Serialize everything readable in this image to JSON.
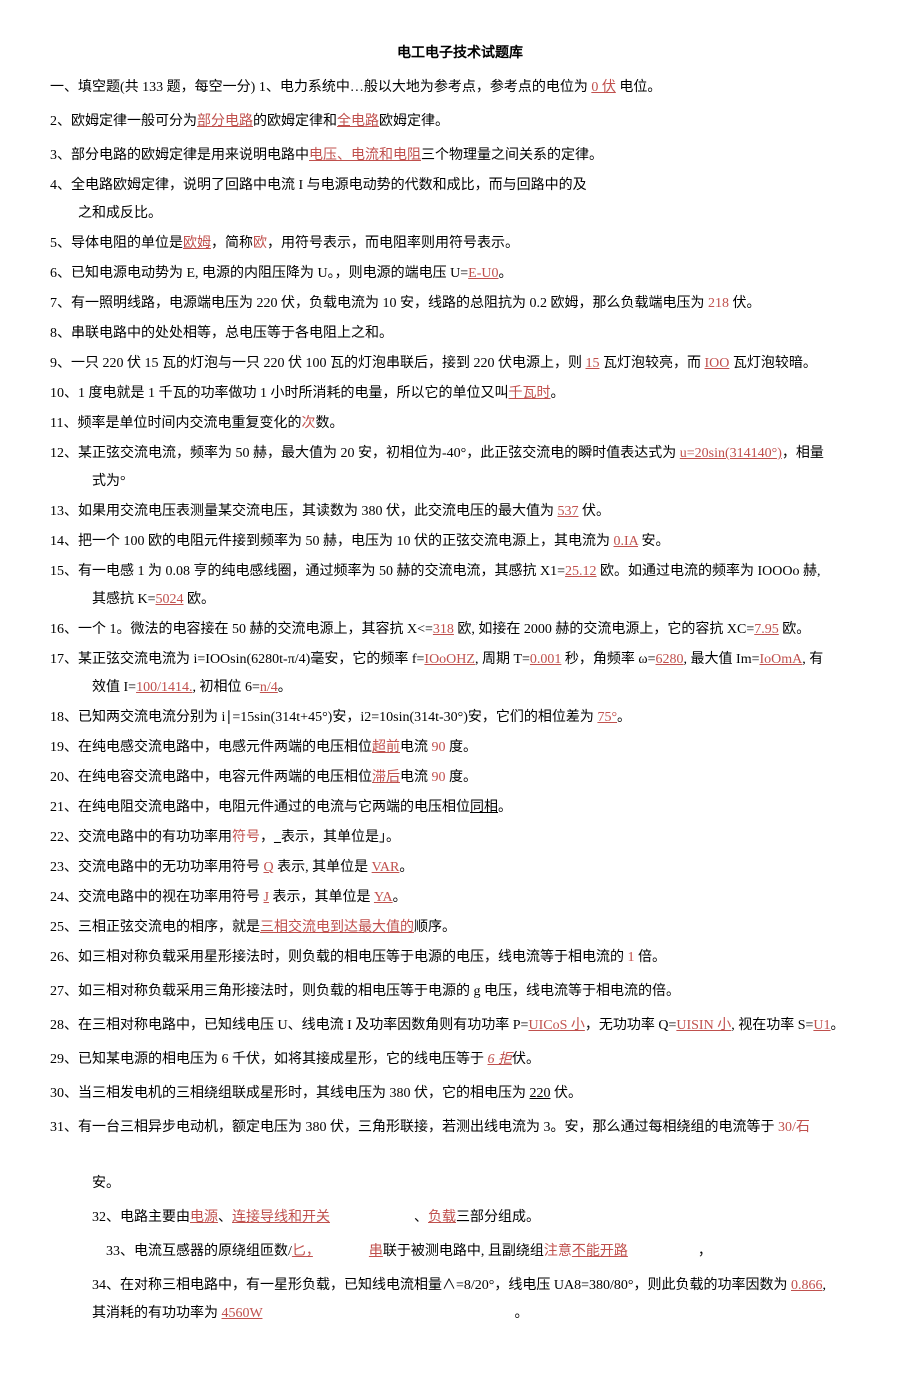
{
  "title": "电工电子技术试题库",
  "header_line_prefix": "一、填空题(共 133 题，每空一分) 1、电力系统中…般以大地为参考点，参考点的电位为 ",
  "header_line_ans": "0 伏",
  "header_line_suffix": " 电位。",
  "rows": {
    "r2": {
      "pre": "2、欧姆定律一般可分为",
      "a1": "部分电路",
      "mid": "的欧姆定律和",
      "a2": "全电路",
      "suf": "欧姆定律。"
    },
    "r3": {
      "pre": "3、部分电路的欧姆定律是用来说明电路中",
      "a1": "电压、电流和电阻",
      "suf": "三个物理量之间关系的定律。"
    },
    "r4": {
      "l1": "4、全电路欧姆定律，说明了回路中电流 I 与电源电动势的代数和成比，而与回路中的及",
      "l2": "之和成反比。"
    },
    "r5": {
      "pre": "5、导体电阻的单位是",
      "a1": "欧姆",
      "mid": "，简称",
      "a2": "欧",
      "suf": "，用符号表示，而电阻率则用符号表示。"
    },
    "r6": {
      "pre": "6、已知电源电动势为 E, 电源的内阻压降为 U。，则电源的端电压 U=",
      "a1": "E-U0",
      "suf": "。"
    },
    "r7": {
      "pre": "7、有一照明线路，电源端电压为 220 伏，负载电流为 10 安，线路的总阻抗为 0.2 欧姆，那么负载端电压为 ",
      "a1": "218",
      "suf": " 伏。"
    },
    "r8": {
      "text": "8、串联电路中的处处相等，总电压等于各电阻上之和。"
    },
    "r9": {
      "pre": "9、一只 220 伏 15 瓦的灯泡与一只 220 伏 100 瓦的灯泡串联后，接到 220 伏电源上，则 ",
      "a1": "15",
      "mid": " 瓦灯泡较亮，而 ",
      "a2": "IOO",
      "suf": " 瓦灯泡较暗。"
    },
    "r10": {
      "pre": "10、1 度电就是 1 千瓦的功率做功 1 小时所消耗的电量，所以它的单位又叫",
      "a1": "千瓦时",
      "suf": "。"
    },
    "r11": {
      "pre": "11、频率是单位时间内交流电重复变化的",
      "a1": "次",
      "suf": "数。"
    },
    "r12": {
      "l1_pre": "12、某正弦交流电流，频率为 50 赫，最大值为 20 安，初相位为-40°，此正弦交流电的瞬时值表达式为 ",
      "l1_a": "u=20sin(314140°)",
      "l1_suf": "，相量",
      "l2": "式为°"
    },
    "r13": {
      "pre": "13、如果用交流电压表测量某交流电压，其读数为 380 伏，此交流电压的最大值为 ",
      "a1": "537",
      "suf": " 伏。"
    },
    "r14": {
      "pre": "14、把一个 100 欧的电阻元件接到频率为 50 赫，电压为 10 伏的正弦交流电源上，其电流为 ",
      "a1": "0.IA",
      "suf": " 安。"
    },
    "r15": {
      "l1_pre": "15、有一电感 1 为 0.08 亨的纯电感线圈，通过频率为 50 赫的交流电流，其感抗 X1=",
      "l1_a": "25.12",
      "l1_suf": " 欧。如通过电流的频率为 IOOOo 赫,",
      "l2_pre": "其感抗 K=",
      "l2_a": "5024",
      "l2_suf": " 欧。"
    },
    "r16": {
      "pre": "16、一个 1。微法的电容接在 50 赫的交流电源上，其容抗 X<=",
      "a1": "318",
      "mid": " 欧, 如接在 2000 赫的交流电源上，它的容抗 XC=",
      "a2": "7.95",
      "suf": " 欧。"
    },
    "r17": {
      "l1_pre": "17、某正弦交流电流为 i=IOOsin(6280t-π/4)毫安，它的频率 f=",
      "l1_a1": "IOoOHZ",
      "l1_m1": ", 周期 T=",
      "l1_a2": "0.001",
      "l1_m2": " 秒，角频率 ω=",
      "l1_a3": "6280",
      "l1_m3": ", 最大值 Im=",
      "l1_a4": "IoOmA",
      "l1_suf": ", 有",
      "l2_pre": "效值 I=",
      "l2_a1": "100/1414.",
      "l2_m": ", 初相位 6=",
      "l2_a2": "n/4",
      "l2_suf": "。"
    },
    "r18": {
      "pre": "18、已知两交流电流分别为 i∣=15sin(314t+45°)安，i2=10sin(314t-30°)安，它们的相位差为 ",
      "a1": "75°",
      "suf": "。"
    },
    "r19": {
      "pre": "19、在纯电感交流电路中，电感元件两端的电压相位",
      "a1": "超前",
      "mid": "电流 ",
      "a2": "90",
      "suf": " 度。"
    },
    "r20": {
      "pre": "20、在纯电容交流电路中，电容元件两端的电压相位",
      "a1": "滞后",
      "mid": "电流 ",
      "a2": "90",
      "suf": " 度。"
    },
    "r21": {
      "pre": "21、在纯电阻交流电路中，电阻元件通过的电流与它两端的电压相位",
      "u": "同相",
      "suf": "。"
    },
    "r22": {
      "pre": "22、交流电路中的有功功率用",
      "a1": "符号",
      "mid": "，",
      "u": "_",
      "suf": "表示，其单位是」。"
    },
    "r23": {
      "pre": "23、交流电路中的无功功率用符号 ",
      "a1": "Q",
      "mid": " 表示, 其单位是 ",
      "a2": "VAR",
      "suf": "。"
    },
    "r24": {
      "pre": "24、交流电路中的视在功率用符号 ",
      "a1": "J",
      "mid": " 表示，其单位是 ",
      "a2": "YA",
      "suf": "。"
    },
    "r25": {
      "pre": "25、三相正弦交流电的相序，就是",
      "a1": "三相交流电到达最大值的",
      "suf": "顺序。"
    },
    "r26": {
      "pre": "26、如三相对称负载采用星形接法时，则负载的相电压等于电源的电压，线电流等于相电流的 ",
      "a1": "1",
      "suf": " 倍。"
    },
    "r27": {
      "text": "27、如三相对称负载采用三角形接法时，则负载的相电压等于电源的 g 电压，线电流等于相电流的倍。"
    },
    "r28": {
      "pre": "28、在三相对称电路中，已知线电压 U、线电流 I 及功率因数角则有功功率 P=",
      "a1": "UICoS 小",
      "mid": "，无功功率 Q=",
      "a2": "UISIN 小",
      "mid2": ", 视在功率 S=",
      "a3": "U1",
      "suf": "。"
    },
    "r29": {
      "pre": "29、已知某电源的相电压为 6 千伏，如将其接成星形，它的线电压等于 ",
      "a1": "6 拒",
      "suf": "伏。"
    },
    "r30": {
      "pre": "30、当三相发电机的三相绕组联成星形时，其线电压为 380 伏，它的相电压为 ",
      "a1": "220",
      "suf": " 伏。"
    },
    "r31": {
      "l1_pre": "31、有一台三相异步电动机，额定电压为 380 伏，三角形联接，若测出线电流为 3。安，那么通过每相绕组的电流等于 ",
      "l1_a": "30/石",
      "l2": "安。"
    },
    "r32": {
      "pre": "32、电路主要由",
      "a1": "电源",
      "m1": "、",
      "a2": "连接导线和开关",
      "gap": "　　　　　　",
      "m2": "、",
      "a3": "负载",
      "suf": "三部分组成。"
    },
    "r33": {
      "pre": "33、电流互感器的原绕组匝数/",
      "a1": "匕，",
      "gap": "　　　　",
      "a2": "串",
      "mid": "联于被测电路中, 且副绕组",
      "a3": "注意",
      "a4": "不能开路",
      "gap2": "　　　　　",
      "suf": "，"
    },
    "r34": {
      "l1_pre": "34、在对称三相电路中，有一星形负载，已知线电流相量∧=8/20°，线电压 UA8=380/80°，则此负载的功率因数为 ",
      "l1_a": "0.866",
      "l1_suf": ",",
      "l2_pre": "其消耗的有功功率为 ",
      "l2_a": "4560W",
      "l2_gap": "　　　　　　　　　　　　　　　　　　",
      "l2_suf": "。"
    }
  }
}
